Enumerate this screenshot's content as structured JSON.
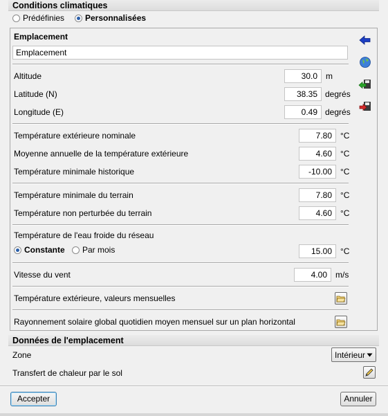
{
  "climate": {
    "title": "Conditions climatiques",
    "option_predefined": "Prédéfinies",
    "option_custom": "Personnalisées",
    "selected_option": "Personnalisées"
  },
  "location": {
    "title": "Emplacement",
    "name_value": "Emplacement"
  },
  "coords": {
    "altitude_label": "Altitude",
    "altitude_value": "30.0",
    "altitude_unit": "m",
    "latitude_label": "Latitude (N)",
    "latitude_value": "38.35",
    "latitude_unit": "degrés",
    "longitude_label": "Longitude (E)",
    "longitude_value": "0.49",
    "longitude_unit": "degrés"
  },
  "exterior": {
    "nominal_label": "Température extérieure nominale",
    "nominal_value": "7.80",
    "annual_label": "Moyenne annuelle de la température extérieure",
    "annual_value": "4.60",
    "min_label": "Température minimale historique",
    "min_value": "-10.00",
    "unit": "°C"
  },
  "ground": {
    "min_label": "Température minimale du terrain",
    "min_value": "7.80",
    "undisturbed_label": "Température non perturbée du terrain",
    "undisturbed_value": "4.60",
    "unit": "°C"
  },
  "water": {
    "label": "Température de l'eau froide du réseau",
    "option_constant": "Constante",
    "option_monthly": "Par mois",
    "selected_option": "Constante",
    "value": "15.00",
    "unit": "°C"
  },
  "wind": {
    "label": "Vitesse du vent",
    "value": "4.00",
    "unit": "m/s"
  },
  "monthly_temp": {
    "label": "Température extérieure, valeurs mensuelles"
  },
  "solar": {
    "label": "Rayonnement solaire global quotidien moyen mensuel sur un plan horizontal"
  },
  "site_data": {
    "title": "Données de l'emplacement",
    "zone_label": "Zone",
    "zone_value": "Intérieur",
    "ground_transfer_label": "Transfert de chaleur par le sol"
  },
  "buttons": {
    "accept": "Accepter",
    "cancel": "Annuler"
  },
  "icons": [
    "back-arrow-icon",
    "globe-icon",
    "import-icon",
    "export-icon",
    "folder-icon",
    "edit-pencil-icon",
    "dropdown-arrow-icon"
  ]
}
